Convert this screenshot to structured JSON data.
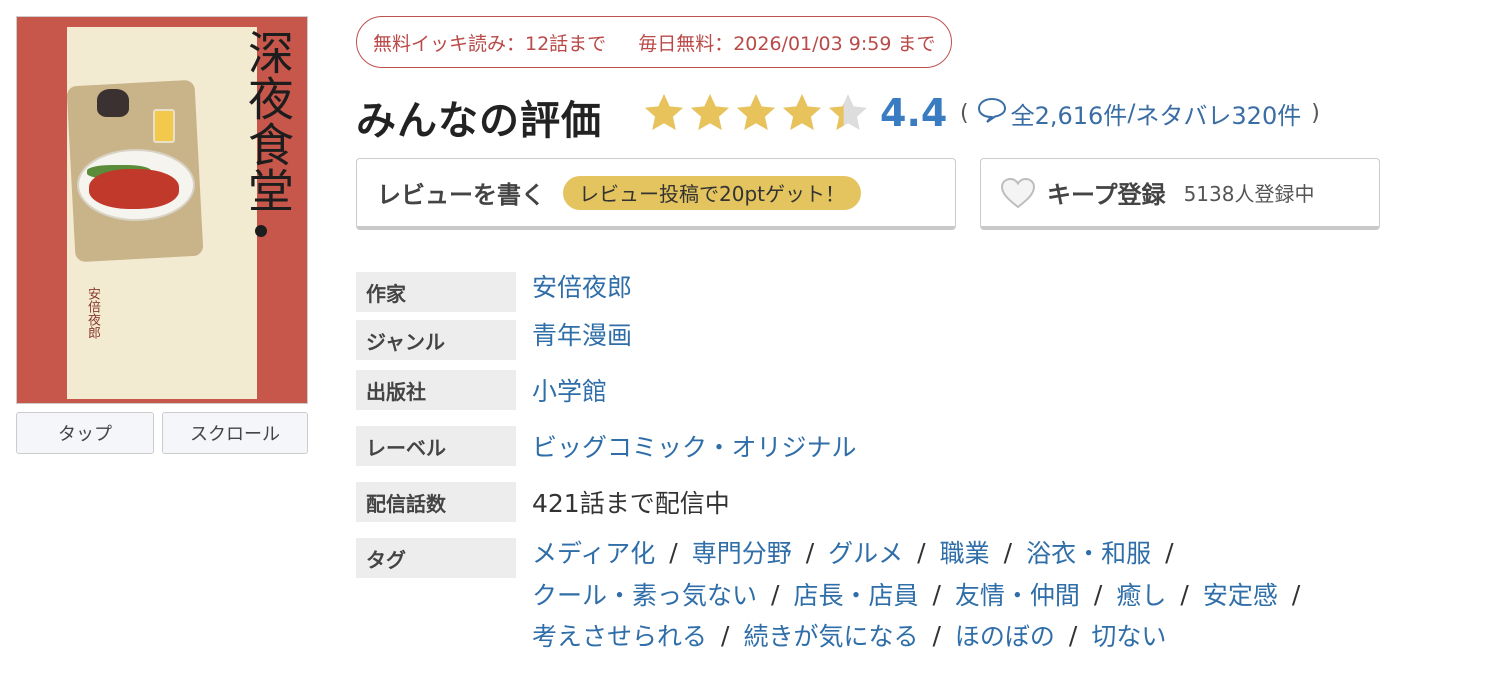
{
  "cover": {
    "title": "深夜食堂",
    "author": "安倍夜郎",
    "tap_label": "タップ",
    "scroll_label": "スクロール"
  },
  "free_badge": {
    "free_read": "無料イッキ読み：12話まで",
    "daily_free": "毎日無料：2026/01/03 9:59 まで"
  },
  "rating": {
    "title": "みんなの評価",
    "value": "4.4",
    "stars_value": 4.4,
    "stars_max": 5,
    "paren_open": "(",
    "paren_close": ")",
    "review_count": "全2,616件",
    "slash": "/",
    "spoiler_count": "ネタバレ320件",
    "star_color": "#e8c25a",
    "star_empty_color": "#dddddd",
    "accent_color": "#3a7cc2"
  },
  "actions": {
    "write_review_label": "レビューを書く",
    "write_review_badge": "レビュー投稿で20ptゲット！",
    "keep_label": "キープ登録",
    "keep_count": "5138人登録中"
  },
  "info": {
    "author_label": "作家",
    "author_value": "安倍夜郎",
    "genre_label": "ジャンル",
    "genre_value": "青年漫画",
    "publisher_label": "出版社",
    "publisher_value": "小学館",
    "label_label": "レーベル",
    "label_value": "ビッグコミック・オリジナル",
    "episodes_label": "配信話数",
    "episodes_value": "421話まで配信中",
    "tags_label": "タグ",
    "tags": [
      "メディア化",
      "専門分野",
      "グルメ",
      "職業",
      "浴衣・和服",
      "クール・素っ気ない",
      "店長・店員",
      "友情・仲間",
      "癒し",
      "安定感",
      "考えさせられる",
      "続きが気になる",
      "ほのぼの",
      "切ない"
    ],
    "tag_separator": "/"
  },
  "icons": {
    "speech_bubble": "speech-bubble-icon",
    "heart": "heart-icon",
    "star": "star-icon"
  }
}
